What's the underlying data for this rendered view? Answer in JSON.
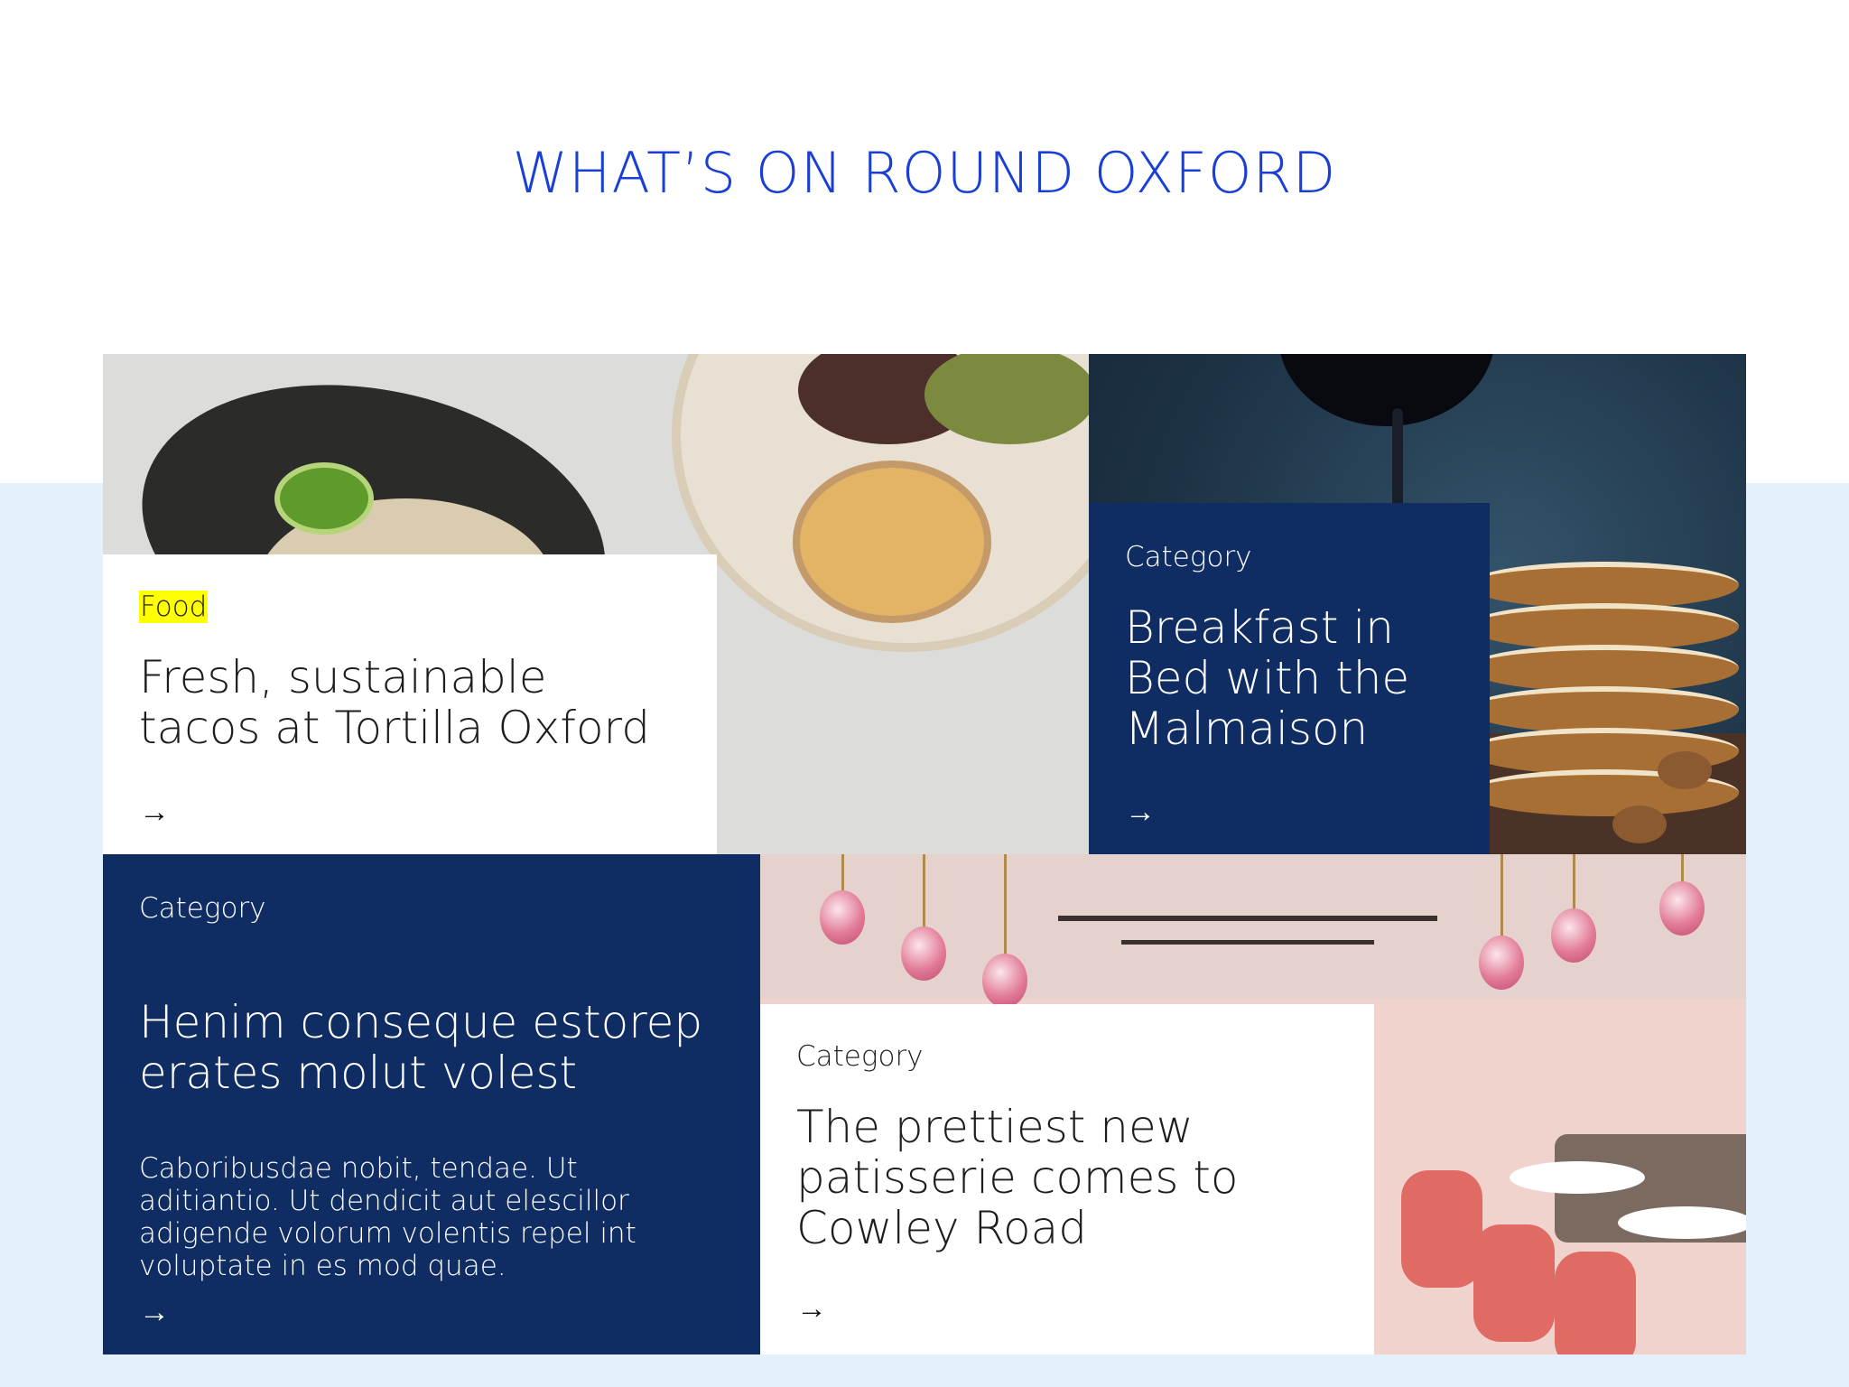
{
  "section": {
    "title": "WHAT’S ON ROUND OXFORD"
  },
  "cards": [
    {
      "category": "Food",
      "headline": "Fresh, sustainable tacos at Tortilla Oxford",
      "arrow": "→",
      "image": "tacos-photo"
    },
    {
      "category": "Category",
      "headline": "Breakfast in Bed with the Malmaison",
      "arrow": "→",
      "image": "pancakes-photo"
    },
    {
      "category": "Category",
      "headline": "Henim conseque estorep erates molut volest",
      "body": "Caboribusdae nobit, tendae. Ut aditiantio. Ut dendicit aut elescillor adigende volorum volentis repel int voluptate in es mod quae.",
      "arrow": "→"
    },
    {
      "category": "Category",
      "headline": "The prettiest new patisserie comes to Cowley Road",
      "arrow": "→",
      "image": "patisserie-photo"
    }
  ],
  "colors": {
    "title": "#1a3fd6",
    "navy": "#0f2c63",
    "highlight": "#ffff00",
    "band": "#e4f1fd"
  }
}
